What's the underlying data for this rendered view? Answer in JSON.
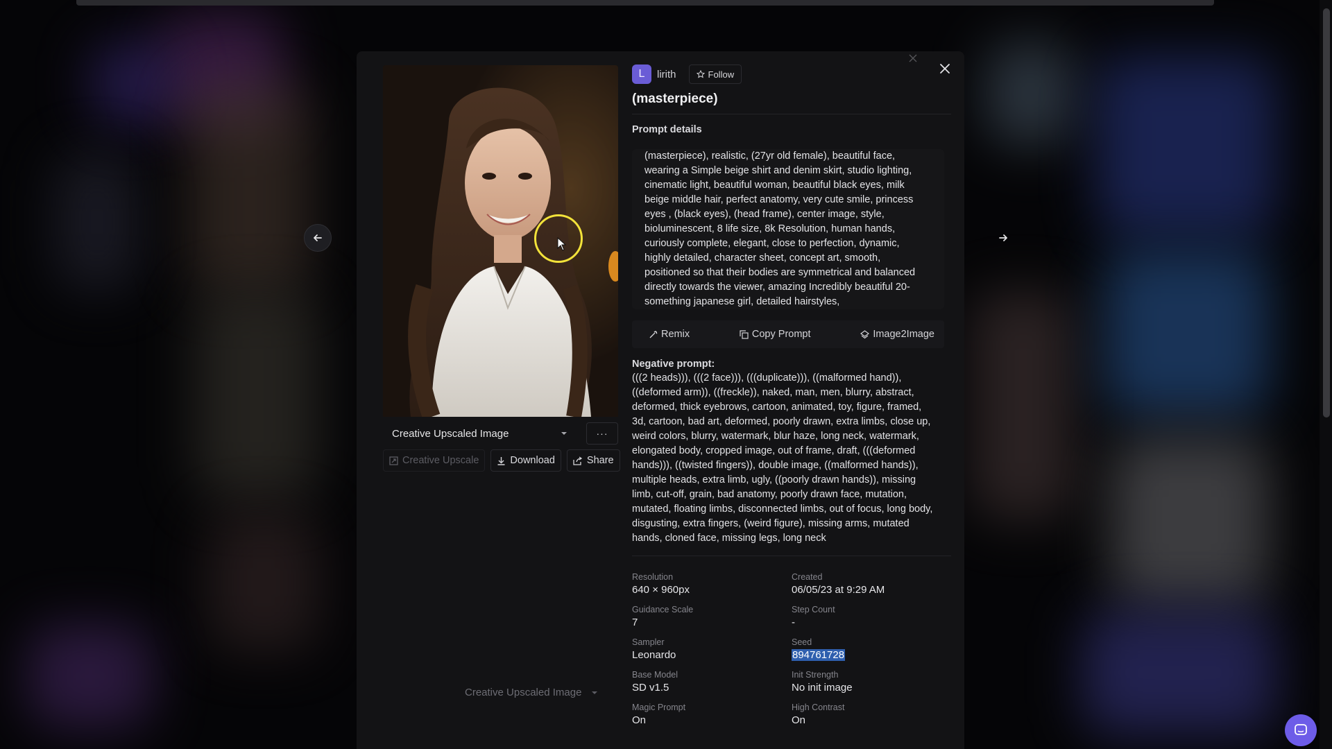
{
  "author": {
    "initial": "L",
    "name": "lirith",
    "follow_label": "Follow"
  },
  "title": "(masterpiece)",
  "prompt": {
    "section_label": "Prompt details",
    "lines": [
      "(masterpiece), realistic, (27yr old female), beautiful face,",
      "wearing a Simple beige shirt and denim skirt, studio lighting,",
      "cinematic light, beautiful woman, beautiful black eyes, milk",
      "beige middle hair, perfect anatomy, very cute smile, princess",
      "eyes , (black eyes), (head frame), center image, style,",
      "bioluminescent, 8 life size, 8k Resolution, human hands,",
      "curiously complete, elegant, close to perfection, dynamic,",
      "highly detailed, character sheet, concept art, smooth,",
      "positioned so that their bodies are symmetrical and balanced",
      "directly towards the viewer, amazing Incredibly beautiful 20-",
      "something japanese girl, detailed hairstyles,"
    ],
    "actions": {
      "remix": "Remix",
      "copy": "Copy Prompt",
      "image2image": "Image2Image"
    }
  },
  "negative": {
    "label": "Negative prompt:",
    "lines": [
      "(((2 heads))), (((2 face))), (((duplicate))), ((malformed hand)),",
      "((deformed arm)), ((freckle)), naked, man, men, blurry, abstract,",
      "deformed, thick eyebrows, cartoon, animated, toy, figure, framed,",
      "3d, cartoon, bad art, deformed, poorly drawn, extra limbs, close up,",
      "weird colors, blurry, watermark, blur haze, long neck, watermark,",
      "elongated body, cropped image, out of frame, draft, (((deformed",
      "hands))), ((twisted fingers)), double image, ((malformed hands)),",
      "multiple heads, extra limb, ugly, ((poorly drawn hands)), missing",
      "limb, cut-off, grain, bad anatomy, poorly drawn face, mutation,",
      "mutated, floating limbs, disconnected limbs, out of focus, long body,",
      "disgusting, extra fingers, (weird figure), missing arms, mutated",
      "hands, cloned face, missing legs, long neck"
    ]
  },
  "meta": [
    {
      "label": "Resolution",
      "value": "640 × 960px"
    },
    {
      "label": "Created",
      "value": "06/05/23 at 9:29 AM"
    },
    {
      "label": "Guidance Scale",
      "value": "7"
    },
    {
      "label": "Step Count",
      "value": "-"
    },
    {
      "label": "Sampler",
      "value": "Leonardo"
    },
    {
      "label": "Seed",
      "value": "894761728"
    },
    {
      "label": "Base Model",
      "value": "SD v1.5"
    },
    {
      "label": "Init Strength",
      "value": "No init image"
    },
    {
      "label": "Magic Prompt",
      "value": "On"
    },
    {
      "label": "High Contrast",
      "value": "On"
    }
  ],
  "image_panel": {
    "variant_label": "Creative Upscaled Image",
    "more_label": "···",
    "creative_upscale": "Creative Upscale",
    "download": "Download",
    "share": "Share",
    "ghost_variant_label": "Creative Upscaled Image"
  },
  "icons": {
    "prev": "arrow-left-icon",
    "next": "arrow-right-icon",
    "close": "close-icon",
    "follow": "star-icon",
    "remix": "wand-icon",
    "copy": "copy-icon",
    "image2image": "layers-icon",
    "download": "download-icon",
    "share": "share-icon",
    "chevron": "chevron-down-icon",
    "chat": "chat-icon"
  },
  "colors": {
    "accent": "#6a5cd6",
    "highlight": "#2f5fae",
    "cursor_ring": "#f2e23a"
  }
}
